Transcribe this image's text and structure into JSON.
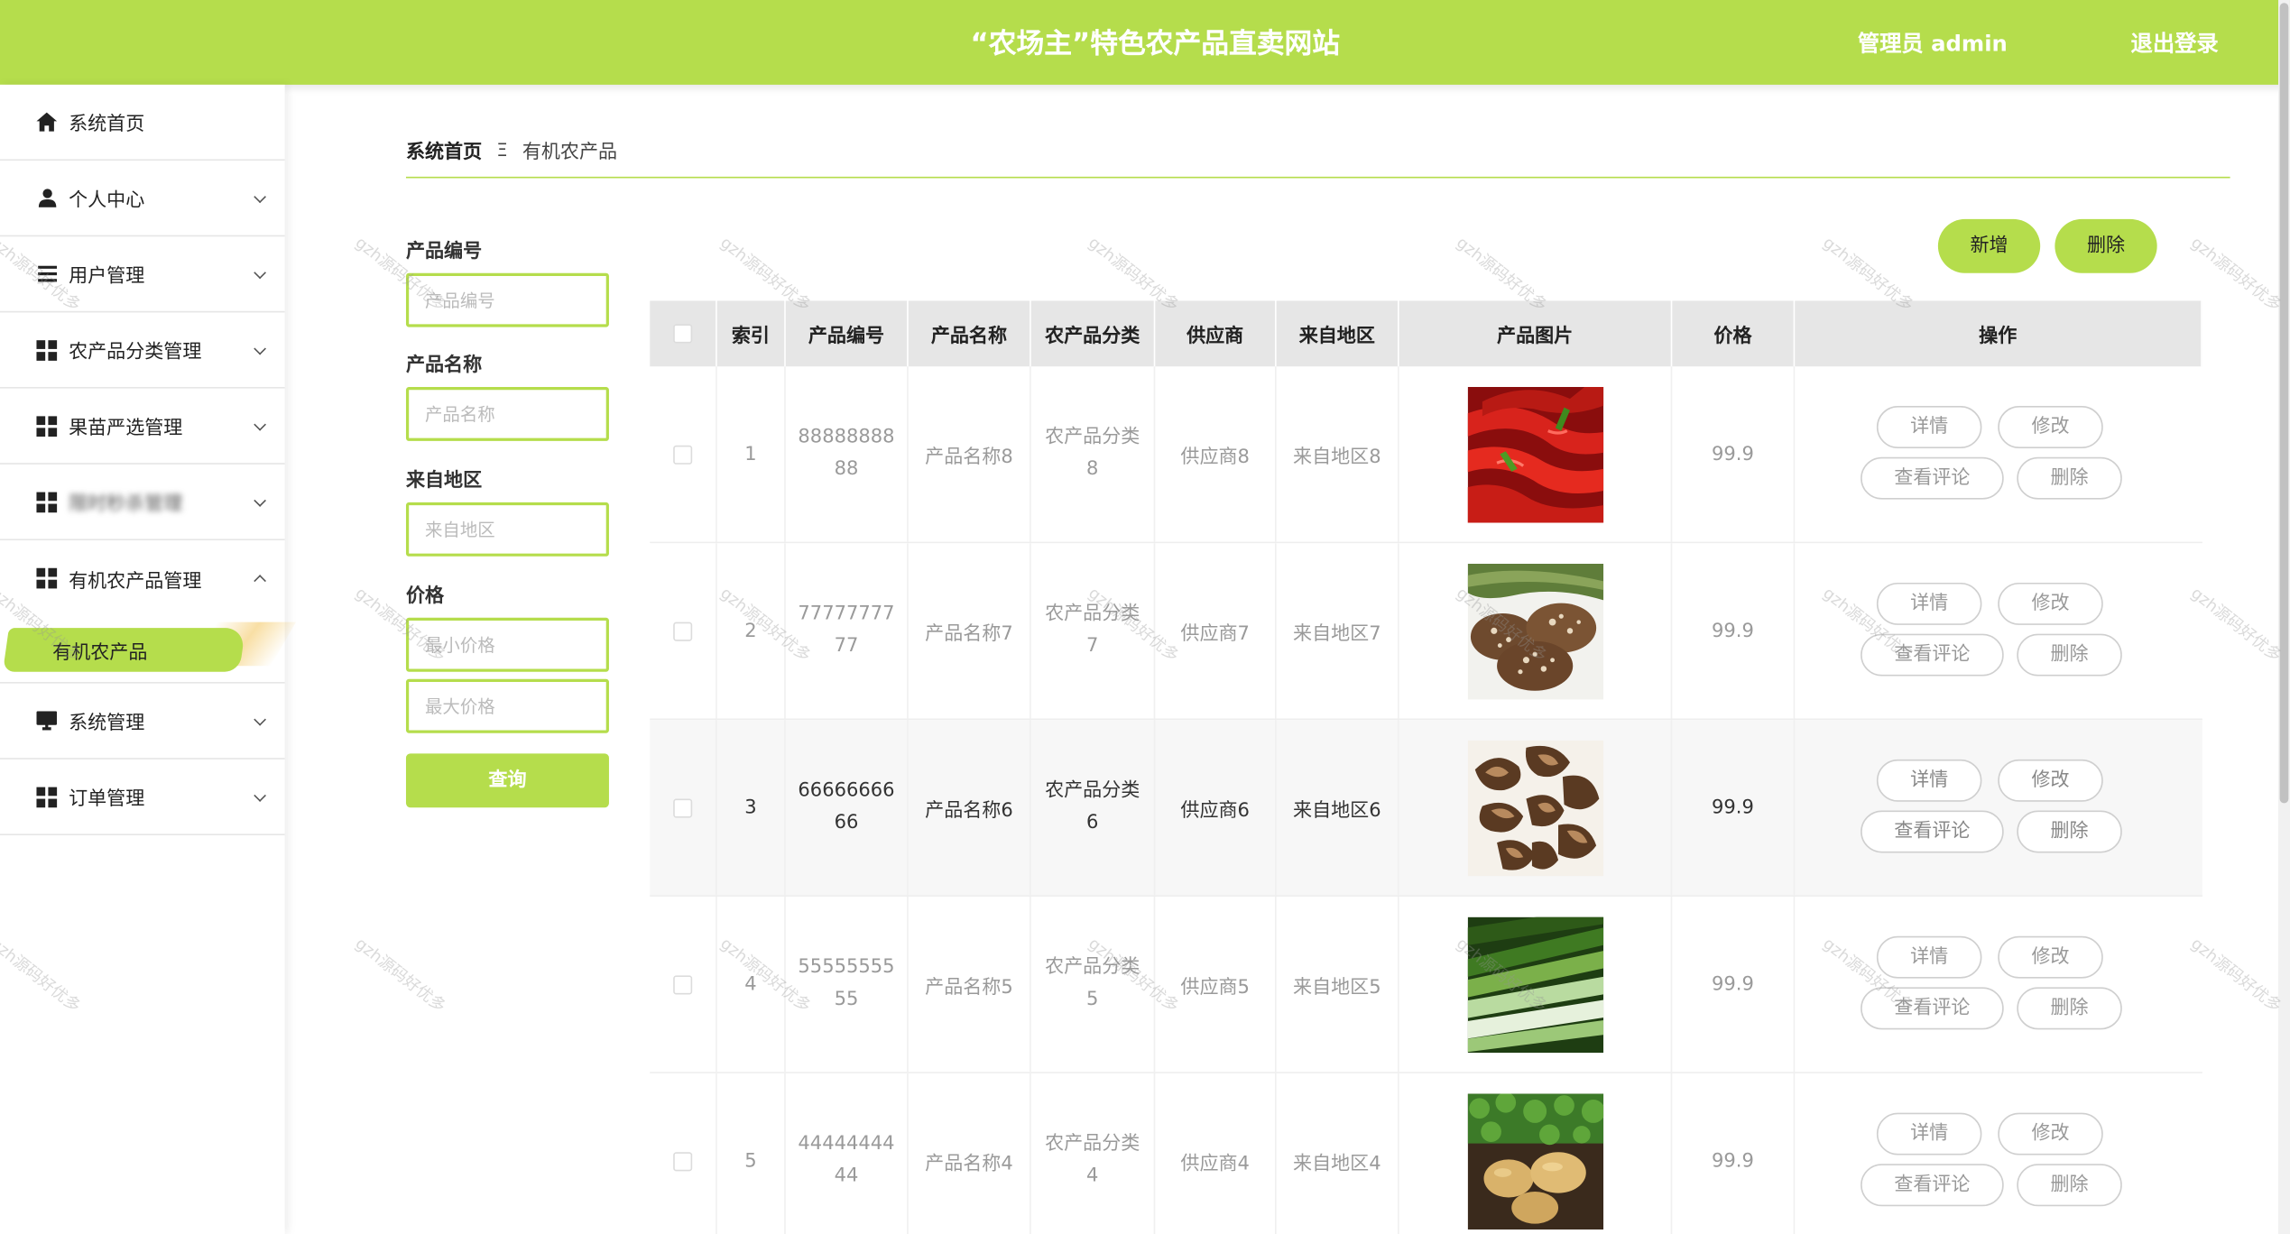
{
  "header": {
    "title": "“农场主”特色农产品直卖网站",
    "admin_label": "管理员 admin",
    "logout_label": "退出登录"
  },
  "colors": {
    "accent": "#b5dd4c",
    "header_text": "#ffffff",
    "table_header_bg": "#e6e6e6"
  },
  "sidebar": {
    "items": [
      {
        "label": "系统首页",
        "icon": "home-icon",
        "expandable": false
      },
      {
        "label": "个人中心",
        "icon": "user-icon",
        "expandable": true
      },
      {
        "label": "用户管理",
        "icon": "list-icon",
        "expandable": true
      },
      {
        "label": "农产品分类管理",
        "icon": "grid-icon",
        "expandable": true
      },
      {
        "label": "果苗严选管理",
        "icon": "grid-icon",
        "expandable": true
      },
      {
        "label": "限时秒杀管理",
        "icon": "grid-icon",
        "expandable": true
      },
      {
        "label": "有机农产品管理",
        "icon": "grid-icon",
        "expandable": true,
        "expanded": true
      },
      {
        "label": "系统管理",
        "icon": "monitor-icon",
        "expandable": true
      },
      {
        "label": "订单管理",
        "icon": "grid-icon",
        "expandable": true
      }
    ],
    "active_sub_item": "有机农产品"
  },
  "breadcrumb": {
    "home": "系统首页",
    "separator": "Ξ",
    "current": "有机农产品"
  },
  "search": {
    "code_label": "产品编号",
    "code_placeholder": "产品编号",
    "name_label": "产品名称",
    "name_placeholder": "产品名称",
    "region_label": "来自地区",
    "region_placeholder": "来自地区",
    "price_label": "价格",
    "min_price_placeholder": "最小价格",
    "max_price_placeholder": "最大价格",
    "query_label": "查询"
  },
  "actions": {
    "add_label": "新增",
    "delete_label": "删除"
  },
  "table": {
    "columns": [
      "索引",
      "产品编号",
      "产品名称",
      "农产品分类",
      "供应商",
      "来自地区",
      "产品图片",
      "价格",
      "操作"
    ],
    "op_labels": {
      "detail": "详情",
      "edit": "修改",
      "review": "查看评论",
      "delete": "删除"
    },
    "rows": [
      {
        "index": "1",
        "code": "8888888888",
        "name": "产品名称8",
        "category": "农产品分类8",
        "supplier": "供应商8",
        "region": "来自地区8",
        "image": "red-chili-peppers",
        "price": "99.9"
      },
      {
        "index": "2",
        "code": "7777777777",
        "name": "产品名称7",
        "category": "农产品分类7",
        "supplier": "供应商7",
        "region": "来自地区7",
        "image": "shiitake-mushrooms",
        "price": "99.9"
      },
      {
        "index": "3",
        "code": "6666666666",
        "name": "产品名称6",
        "category": "农产品分类6",
        "supplier": "供应商6",
        "region": "来自地区6",
        "image": "dried-mushrooms",
        "price": "99.9"
      },
      {
        "index": "4",
        "code": "5555555555",
        "name": "产品名称5",
        "category": "农产品分类5",
        "supplier": "供应商5",
        "region": "来自地区5",
        "image": "green-leeks",
        "price": "99.9"
      },
      {
        "index": "5",
        "code": "4444444444",
        "name": "产品名称4",
        "category": "农产品分类4",
        "supplier": "供应商4",
        "region": "来自地区4",
        "image": "potatoes-in-soil",
        "price": "99.9"
      }
    ]
  },
  "watermark": "gzh源码好优多"
}
